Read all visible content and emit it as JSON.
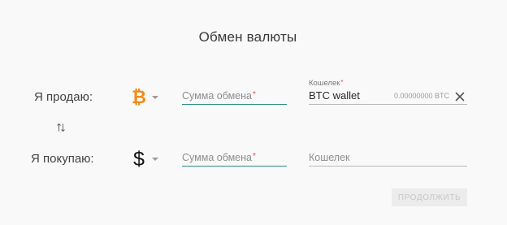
{
  "header": {
    "title": "Обмен валюты"
  },
  "sell": {
    "label": "Я продаю:",
    "currency_icon": "bitcoin-icon",
    "amount_placeholder": "Сумма обмена",
    "wallet_label": "Кошелек",
    "wallet_value": "BTC wallet",
    "balance": "0.00000000 BTC"
  },
  "buy": {
    "label": "Я покупаю:",
    "currency_icon": "dollar-icon",
    "amount_placeholder": "Сумма обмена",
    "wallet_placeholder": "Кошелек"
  },
  "actions": {
    "continue_label": "ПРОДОЛЖИТЬ"
  },
  "colors": {
    "accent": "#2d8f82",
    "bitcoin": "#f28b1a",
    "required": "#e5484d"
  }
}
